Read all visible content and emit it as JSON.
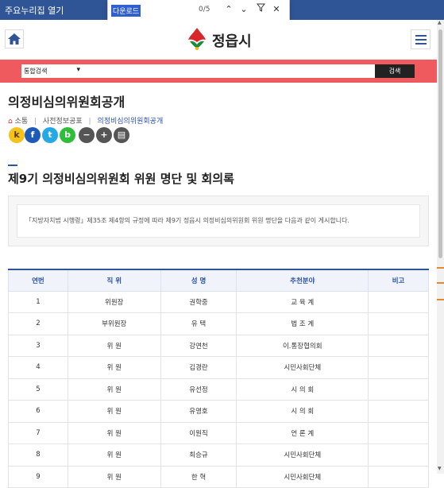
{
  "browser": {
    "favorites_label": "주요누리집 열기"
  },
  "find_bar": {
    "query": "다운로드",
    "count": "0/5",
    "up_icon": "chevron-up-icon",
    "down_icon": "chevron-down-icon",
    "filter_icon": "filter-icon",
    "close_icon": "close-icon"
  },
  "header": {
    "logo_text": "정읍시",
    "home_icon": "home-icon",
    "menu_icon": "hamburger-menu-icon"
  },
  "search": {
    "select_value": "통합검색",
    "input_value": "",
    "button_label": "검색"
  },
  "page": {
    "title": "의정비심의위원회공개",
    "breadcrumb": [
      "소통",
      "사전정보공표",
      "의정비심의위원회공개"
    ],
    "sub_title": "제9기 의정비심의위원회 위원 명단 및 회의록",
    "notice": "「지방자치법 시행령」제35조 제4항의 규정에 따라 제9기 정읍시 의정비심의위원회 위원 명단을 다음과 같이 게시합니다."
  },
  "social": {
    "icons": [
      "kakaostory-icon",
      "facebook-icon",
      "twitter-icon",
      "band-icon",
      "zoom-out-icon",
      "zoom-in-icon",
      "print-icon"
    ],
    "glyphs": [
      "k",
      "f",
      "t",
      "b",
      "−",
      "+",
      "▤"
    ]
  },
  "colors": {
    "accent_blue": "#2f5597",
    "search_bar_red": "#ef5a5f",
    "breadcrumb_current": "#2a50a8"
  },
  "table": {
    "headers": [
      "연번",
      "직 위",
      "성 명",
      "추천분야",
      "비고"
    ],
    "rows": [
      [
        "1",
        "위원장",
        "권학중",
        "교 육 계",
        ""
      ],
      [
        "2",
        "부위원장",
        "유 택",
        "법 조 계",
        ""
      ],
      [
        "3",
        "위 원",
        "강연천",
        "이.통장협의회",
        ""
      ],
      [
        "4",
        "위 원",
        "김경란",
        "시민사회단체",
        ""
      ],
      [
        "5",
        "위 원",
        "유선정",
        "시 의 회",
        ""
      ],
      [
        "6",
        "위 원",
        "유영호",
        "시 의 회",
        ""
      ],
      [
        "7",
        "위 원",
        "이원직",
        "언 론 계",
        ""
      ],
      [
        "8",
        "위 원",
        "최승규",
        "시민사회단체",
        ""
      ],
      [
        "9",
        "위 원",
        "한 혁",
        "시민사회단체",
        ""
      ]
    ]
  }
}
